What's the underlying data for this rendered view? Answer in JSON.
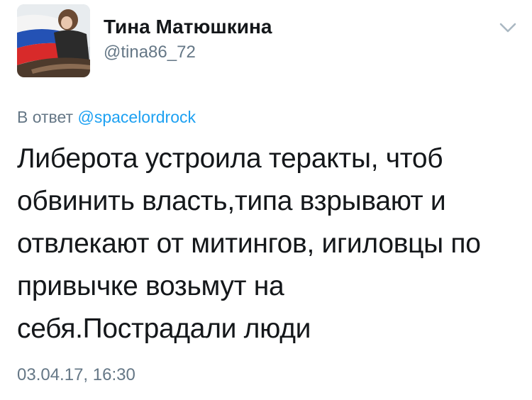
{
  "author": {
    "display_name": "Тина Матюшкина",
    "handle": "@tina86_72"
  },
  "reply": {
    "prefix": "В ответ",
    "mention": "@spacelordrock"
  },
  "tweet": {
    "lines": [
      "Либерота устроила теракты, чтоб",
      "обвинить власть,типа взрывают и",
      "отвлекают от митингов, игиловцы по",
      "привычке возьмут на",
      "себя.Пострадали люди"
    ],
    "timestamp": "03.04.17, 16:30"
  },
  "icons": {
    "menu": "chevron-down-icon",
    "avatar": "avatar"
  },
  "colors": {
    "accent": "#1da1f2",
    "secondary_text": "#657786",
    "primary_text": "#14171a"
  }
}
